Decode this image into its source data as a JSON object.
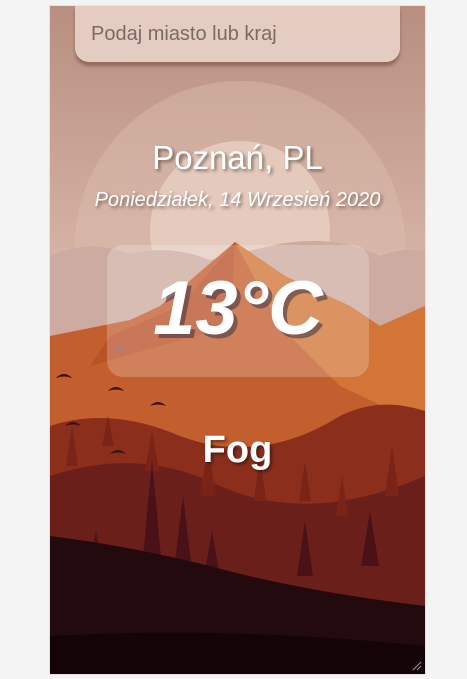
{
  "search": {
    "placeholder": "Podaj miasto lub kraj",
    "value": ""
  },
  "location": {
    "name": "Poznań, PL"
  },
  "date": {
    "text": "Poniedziałek, 14 Wrzesień 2020"
  },
  "weather": {
    "temperature": "13°C",
    "description": "Fog"
  },
  "colors": {
    "sky_top": "#b88f80",
    "sky_bottom": "#e6c6b8",
    "mountain": "#c1582a",
    "hills": "#8a2c1a",
    "forest": "#3c0f16",
    "ground": "#1b0609"
  }
}
